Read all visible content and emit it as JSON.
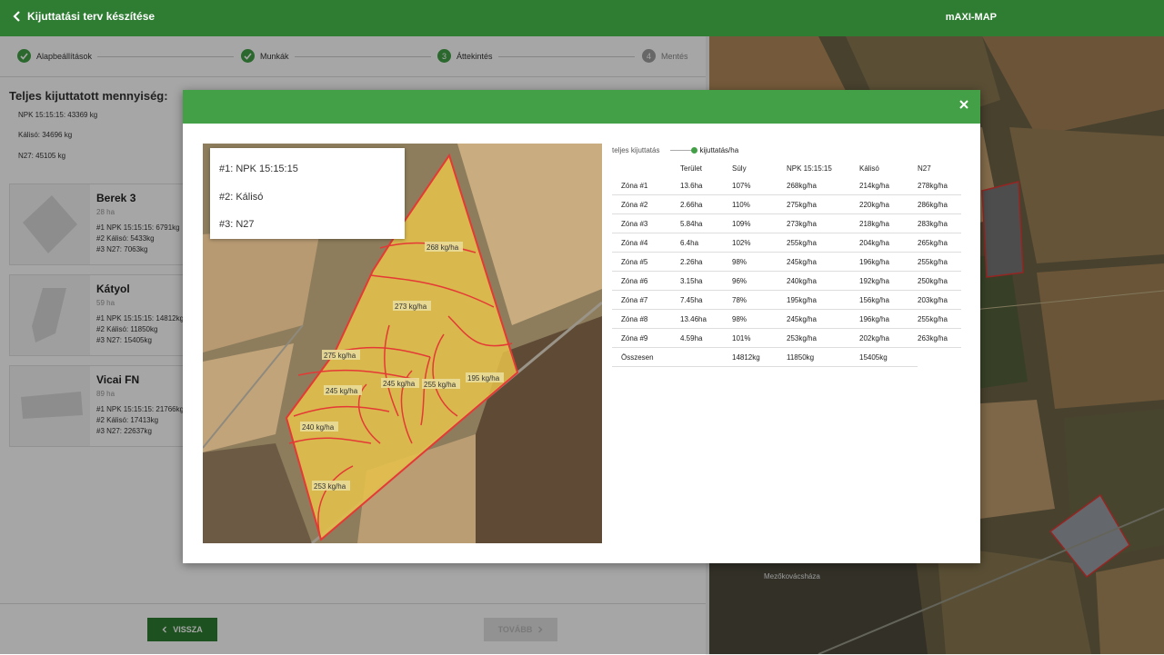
{
  "topbar": {
    "back_label": "Kijuttatási terv készítése",
    "brand": "mAXI-MAP"
  },
  "stepper": {
    "steps": [
      {
        "number": "",
        "label": "Alapbeállítások"
      },
      {
        "number": "",
        "label": "Munkák"
      },
      {
        "number": "3",
        "label": "Áttekintés"
      },
      {
        "number": "4",
        "label": "Mentés"
      }
    ]
  },
  "totals": {
    "title": "Teljes kijuttatott mennyiség:",
    "lines": [
      "NPK 15:15:15: 43369 kg",
      "Kálisó: 34696 kg",
      "N27: 45105 kg"
    ]
  },
  "fields": [
    {
      "name": "Berek 3",
      "area": "28 ha",
      "lines": [
        "#1 NPK 15:15:15: 6791kg",
        "#2 Kálisó: 5433kg",
        "#3 N27: 7063kg"
      ]
    },
    {
      "name": "Kátyol",
      "area": "59 ha",
      "lines": [
        "#1 NPK 15:15:15: 14812kg",
        "#2 Kálisó: 11850kg",
        "#3 N27: 15405kg"
      ]
    },
    {
      "name": "Vicai FN",
      "area": "89 ha",
      "lines": [
        "#1 NPK 15:15:15: 21766kg",
        "#2 Kálisó: 17413kg",
        "#3 N27: 22637kg"
      ]
    }
  ],
  "bottom": {
    "back_label": "VISSZA",
    "next_label": "TOVÁBB"
  },
  "modal": {
    "layers": [
      "#1: NPK 15:15:15",
      "#2: Kálisó",
      "#3: N27"
    ],
    "toggle_left": "teljes kijuttatás",
    "toggle_right": "kijuttatás/ha",
    "zone_labels": [
      "268 kg/ha",
      "273 kg/ha",
      "275 kg/ha",
      "245 kg/ha",
      "245 kg/ha",
      "255 kg/ha",
      "195 kg/ha",
      "240 kg/ha",
      "253 kg/ha"
    ],
    "table": {
      "headers": [
        "",
        "Terület",
        "Súly",
        "NPK 15:15:15",
        "Kálisó",
        "N27"
      ],
      "rows": [
        [
          "Zóna #1",
          "13.6ha",
          "107%",
          "268kg/ha",
          "214kg/ha",
          "278kg/ha"
        ],
        [
          "Zóna #2",
          "2.66ha",
          "110%",
          "275kg/ha",
          "220kg/ha",
          "286kg/ha"
        ],
        [
          "Zóna #3",
          "5.84ha",
          "109%",
          "273kg/ha",
          "218kg/ha",
          "283kg/ha"
        ],
        [
          "Zóna #4",
          "6.4ha",
          "102%",
          "255kg/ha",
          "204kg/ha",
          "265kg/ha"
        ],
        [
          "Zóna #5",
          "2.26ha",
          "98%",
          "245kg/ha",
          "196kg/ha",
          "255kg/ha"
        ],
        [
          "Zóna #6",
          "3.15ha",
          "96%",
          "240kg/ha",
          "192kg/ha",
          "250kg/ha"
        ],
        [
          "Zóna #7",
          "7.45ha",
          "78%",
          "195kg/ha",
          "156kg/ha",
          "203kg/ha"
        ],
        [
          "Zóna #8",
          "13.46ha",
          "98%",
          "245kg/ha",
          "196kg/ha",
          "255kg/ha"
        ],
        [
          "Zóna #9",
          "4.59ha",
          "101%",
          "253kg/ha",
          "202kg/ha",
          "263kg/ha"
        ]
      ],
      "total": [
        "Összesen",
        "",
        "14812kg",
        "11850kg",
        "15405kg",
        ""
      ]
    }
  },
  "map": {
    "place_label": "Mezőkovácsháza"
  },
  "colors": {
    "primary": "#2e7d32",
    "accent": "#43a047",
    "zone_fill": "#e6c24a",
    "zone_border": "#e53935"
  }
}
